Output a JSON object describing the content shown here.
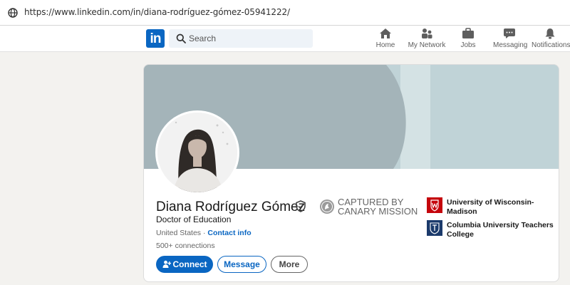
{
  "browser": {
    "url": "https://www.linkedin.com/in/diana-rodríguez-gómez-05941222/"
  },
  "nav": {
    "logo_text": "in",
    "search_placeholder": "Search",
    "items": [
      {
        "label": "Home",
        "icon": "home-icon"
      },
      {
        "label": "My Network",
        "icon": "network-icon"
      },
      {
        "label": "Jobs",
        "icon": "briefcase-icon"
      },
      {
        "label": "Messaging",
        "icon": "chat-icon"
      },
      {
        "label": "Notifications",
        "icon": "bell-icon"
      }
    ]
  },
  "profile": {
    "name": "Diana Rodríguez Gómez",
    "headline": "Doctor of Education",
    "location": "United States",
    "separator": " · ",
    "contact_info": "Contact info",
    "connections": "500+ connections",
    "buttons": {
      "connect": "Connect",
      "message": "Message",
      "more": "More"
    },
    "overlay": {
      "line1": "CAPTURED BY",
      "line2": "CANARY MISSION"
    },
    "education": [
      {
        "line1": "University of Wisconsin-",
        "line2": "Madison",
        "color": "#c5050c"
      },
      {
        "line1": "Columbia University Teachers",
        "line2": "College",
        "color": "#1b3a6b"
      }
    ]
  },
  "colors": {
    "brand": "#0a66c2",
    "banner": "#c0d3d7",
    "banner_shape": "#a4b4b9",
    "page_bg": "#f3f2ef"
  }
}
